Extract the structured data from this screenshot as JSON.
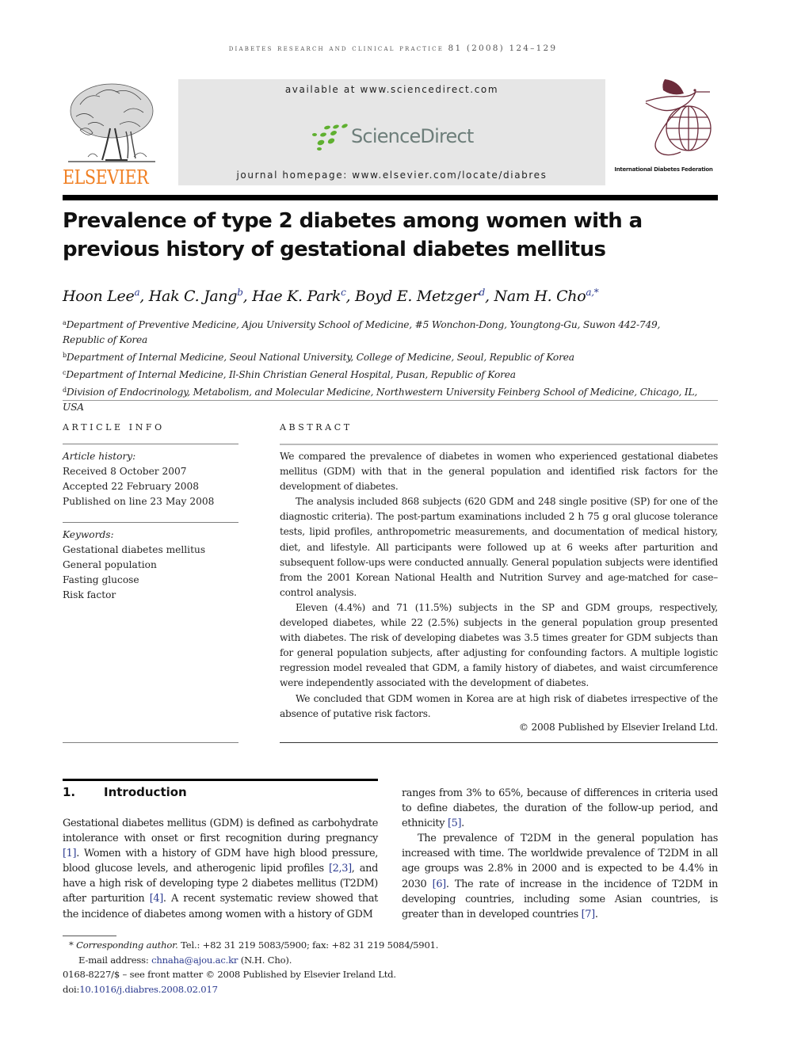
{
  "running_head": "Diabetes Research and Clinical Practice 81 (2008) 124–129",
  "masthead": {
    "publisher_name": "ELSEVIER",
    "available_at": "available at www.sciencedirect.com",
    "sciencedirect_logo_text": "ScienceDirect",
    "journal_homepage": "journal homepage: www.elsevier.com/locate/diabres",
    "partner_logo_text": "International Diabetes Federation",
    "colors": {
      "elsevier_orange": "#f07f22",
      "sciencedirect_green": "#5fb030",
      "idf_maroon": "#6b2b3a"
    }
  },
  "article": {
    "title": "Prevalence of type 2 diabetes among women with a previous history of gestational diabetes mellitus",
    "authors": [
      {
        "name": "Hoon Lee",
        "affil": "a"
      },
      {
        "name": "Hak C. Jang",
        "affil": "b"
      },
      {
        "name": "Hae K. Park",
        "affil": "c"
      },
      {
        "name": "Boyd E. Metzger",
        "affil": "d"
      },
      {
        "name": "Nam H. Cho",
        "affil": "a,*"
      }
    ],
    "affiliations": [
      {
        "key": "a",
        "text": "Department of Preventive Medicine, Ajou University School of Medicine, #5 Wonchon-Dong, Youngtong-Gu, Suwon 442-749,",
        "text2": "Republic of Korea"
      },
      {
        "key": "b",
        "text": "Department of Internal Medicine, Seoul National University, College of Medicine, Seoul, Republic of Korea"
      },
      {
        "key": "c",
        "text": "Department of Internal Medicine, Il-Shin Christian General Hospital, Pusan, Republic of Korea"
      },
      {
        "key": "d",
        "text": "Division of Endocrinology, Metabolism, and Molecular Medicine, Northwestern University Feinberg School of Medicine, Chicago, IL, USA"
      }
    ]
  },
  "article_info": {
    "heading": "ARTICLE INFO",
    "history_label": "Article history:",
    "history": [
      "Received 8 October 2007",
      "Accepted 22 February 2008",
      "Published on line 23 May 2008"
    ],
    "keywords_label": "Keywords:",
    "keywords": [
      "Gestational diabetes mellitus",
      "General population",
      "Fasting glucose",
      "Risk factor"
    ]
  },
  "abstract": {
    "heading": "ABSTRACT",
    "paragraphs": [
      "We compared the prevalence of diabetes in women who experienced gestational diabetes mellitus (GDM) with that in the general population and identified risk factors for the development of diabetes.",
      "The analysis included 868 subjects (620 GDM and 248 single positive (SP) for one of the diagnostic criteria). The post-partum examinations included 2 h 75 g oral glucose tolerance tests, lipid profiles, anthropometric measurements, and documentation of medical history, diet, and lifestyle. All participants were followed up at 6 weeks after parturition and subsequent follow-ups were conducted annually. General population subjects were identified from the 2001 Korean National Health and Nutrition Survey and age-matched for case–control analysis.",
      "Eleven (4.4%) and 71 (11.5%) subjects in the SP and GDM groups, respectively, developed diabetes, while 22 (2.5%) subjects in the general population group presented with diabetes. The risk of developing diabetes was 3.5 times greater for GDM subjects than for general population subjects, after adjusting for confounding factors. A multiple logistic regression model revealed that GDM, a family history of diabetes, and waist circumference were independently associated with the development of diabetes.",
      "We concluded that GDM women in Korea are at high risk of diabetes irrespective of the absence of putative risk factors."
    ],
    "copyright": "© 2008 Published by Elsevier Ireland Ltd."
  },
  "introduction": {
    "number": "1.",
    "heading": "Introduction",
    "col1": {
      "t1": "Gestational diabetes mellitus (GDM) is defined as carbohydrate intolerance with onset or first recognition during pregnancy ",
      "r1": "[1]",
      "t2": ". Women with a history of GDM have high blood pressure, blood glucose levels, and atherogenic lipid profiles ",
      "r2": "[2,3]",
      "t3": ", and have a high risk of developing type 2 diabetes mellitus (T2DM) after parturition ",
      "r3": "[4]",
      "t4": ". A recent systematic review showed that the incidence of diabetes among women with a history of GDM"
    },
    "col2": {
      "p1_t1": "ranges from 3% to 65%, because of differences in criteria used to define diabetes, the duration of the follow-up period, and ethnicity ",
      "p1_r1": "[5]",
      "p1_t2": ".",
      "p2_t1": "The prevalence of T2DM in the general population has increased with time. The worldwide prevalence of T2DM in all age groups was 2.8% in 2000 and is expected to be 4.4% in 2030 ",
      "p2_r1": "[6]",
      "p2_t2": ". The rate of increase in the incidence of T2DM in developing countries, including some Asian countries, is greater than in developed countries ",
      "p2_r2": "[7]",
      "p2_t3": "."
    }
  },
  "footnotes": {
    "corresponding_mark": "*",
    "corresponding_label": "Corresponding author.",
    "contact": " Tel.: +82 31 219 5083/5900; fax: +82 31 219 5084/5901.",
    "email_label": "E-mail address: ",
    "email": "chnaha@ajou.ac.kr",
    "email_suffix": " (N.H. Cho).",
    "issn": "0168-8227/$ – see front matter © 2008 Published by Elsevier Ireland Ltd.",
    "doi_label": "doi:",
    "doi": "10.1016/j.diabres.2008.02.017"
  }
}
